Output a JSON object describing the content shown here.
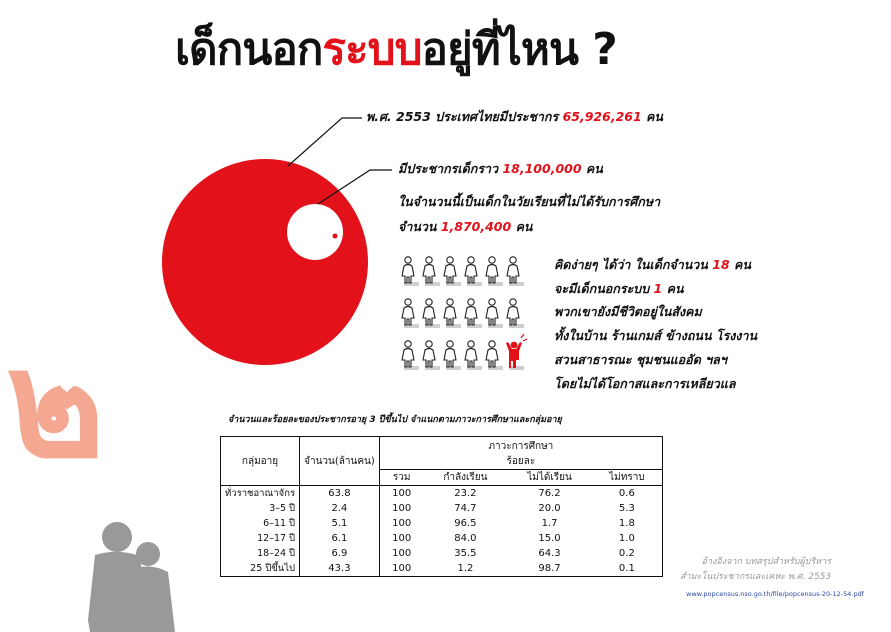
{
  "title": {
    "part1": "เด็กนอก",
    "part2": "ระบบ",
    "part3": "อยู่ที่ไหน ?"
  },
  "population": {
    "prefix": "พ.ศ. 2553 ประเทศไทยมีประชากร",
    "number": "65,926,261",
    "suffix": "คน"
  },
  "children": {
    "prefix": "มีประชากรเด็กราว",
    "number": "18,100,000",
    "suffix": "คน",
    "line2": "ในจำนวนนี้เป็นเด็กในวัยเรียนที่ไม่ได้รับการศึกษา",
    "line3_prefix": "จำนวน",
    "line3_number": "1,870,400",
    "line3_suffix": "คน"
  },
  "explain": {
    "l1_prefix": "คิดง่ายๆ ได้ว่า ในเด็กจำนวน",
    "l1_num": "18",
    "l1_suffix": "คน",
    "l2_prefix": "จะมีเด็กนอกระบบ",
    "l2_num": "1",
    "l2_suffix": "คน",
    "l3": "พวกเขายังมีชีวิตอยู่ในสังคม",
    "l4": "ทั้งในบ้าน ร้านเกมส์ ข้างถนน โรงงาน",
    "l5": "สวนสาธารณะ ชุมชนแออัด ฯลฯ",
    "l6": "โดยไม่ได้โอกาสและการเหลียวแล"
  },
  "pictogram": {
    "total": 18,
    "highlighted": 1,
    "color_normal": "#222222",
    "color_highlight": "#e3111a"
  },
  "chapter_numeral": "๒",
  "colors": {
    "accent": "#e3111a",
    "numeral": "#f4a891",
    "silhouette": "#999999"
  },
  "table": {
    "caption": "จำนวนและร้อยละของประชากรอายุ 3 ปีขึ้นไป จำแนกตามภาวะการศึกษาและกลุ่มอายุ",
    "h_age": "กลุ่มอายุ",
    "h_total": "จำนวน(ล้านคน)",
    "h_status": "ภาวะการศึกษา",
    "h_percent": "ร้อยละ",
    "sub": [
      "รวม",
      "กำลังเรียน",
      "ไม่ได้เรียน",
      "ไม่ทราบ"
    ],
    "rows": [
      [
        "ทั่วราชอาณาจักร",
        "63.8",
        "100",
        "23.2",
        "76.2",
        "0.6"
      ],
      [
        "3–5 ปี",
        "2.4",
        "100",
        "74.7",
        "20.0",
        "5.3"
      ],
      [
        "6–11 ปี",
        "5.1",
        "100",
        "96.5",
        "1.7",
        "1.8"
      ],
      [
        "12–17 ปี",
        "6.1",
        "100",
        "84.0",
        "15.0",
        "1.0"
      ],
      [
        "18–24 ปี",
        "6.9",
        "100",
        "35.5",
        "64.3",
        "0.2"
      ],
      [
        "25 ปีขึ้นไป",
        "43.3",
        "100",
        "1.2",
        "98.7",
        "0.1"
      ]
    ]
  },
  "source": {
    "l1": "อ้างอิงจาก  บทสรุปสำหรับผู้บริหาร",
    "l2": "สำมะโนประชากรและเคหะ พ.ศ. 2553",
    "url": "www.popcensus.nso.go.th/file/popcensus-20-12-54.pdf"
  }
}
